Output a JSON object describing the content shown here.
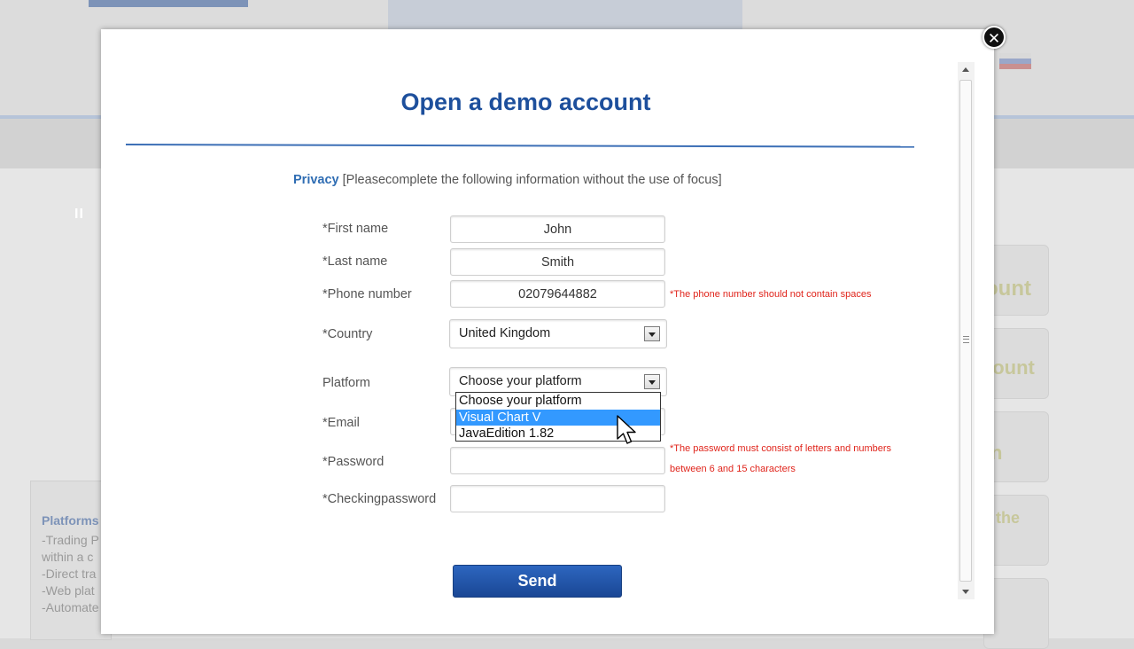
{
  "background": {
    "pause_label": "II",
    "side_panel": {
      "title": "Platforms",
      "lines": [
        "-Trading P",
        "within a c",
        "-Direct tra",
        "-Web plat",
        "-Automate"
      ]
    },
    "right_labels": [
      "ount",
      "count",
      "n",
      "the"
    ]
  },
  "modal": {
    "title": "Open a demo account",
    "privacy_link": "Privacy",
    "privacy_note": "[Pleasecomplete the following information without the use of focus]"
  },
  "form": {
    "first_name": {
      "label": "*First name",
      "value": "John"
    },
    "last_name": {
      "label": "*Last name",
      "value": "Smith"
    },
    "phone": {
      "label": "*Phone number",
      "value": "02079644882",
      "hint": "*The phone number should not contain spaces"
    },
    "country": {
      "label": "*Country",
      "value": "United Kingdom"
    },
    "platform": {
      "label": "Platform",
      "value": "Choose your platform",
      "options": [
        "Choose your platform",
        "Visual Chart V",
        "JavaEdition 1.82"
      ],
      "highlighted": "Visual Chart V"
    },
    "email": {
      "label": "*Email",
      "value": ""
    },
    "password": {
      "label": "*Password",
      "value": "",
      "hint_line1": "*The password must consist of letters and numbers",
      "hint_line2": "between 6 and 15 characters"
    },
    "checking_password": {
      "label": "*Checkingpassword",
      "value": ""
    },
    "send_label": "Send"
  },
  "colors": {
    "title": "#1d4f9c",
    "link": "#2f6db3",
    "hint_red": "#e0241b",
    "send_button": "#1f53a8",
    "option_highlight": "#3399ff"
  },
  "icons": {
    "close": "close-icon",
    "dropdown_arrow": "chevron-down-icon",
    "cursor": "mouse-pointer-icon"
  }
}
